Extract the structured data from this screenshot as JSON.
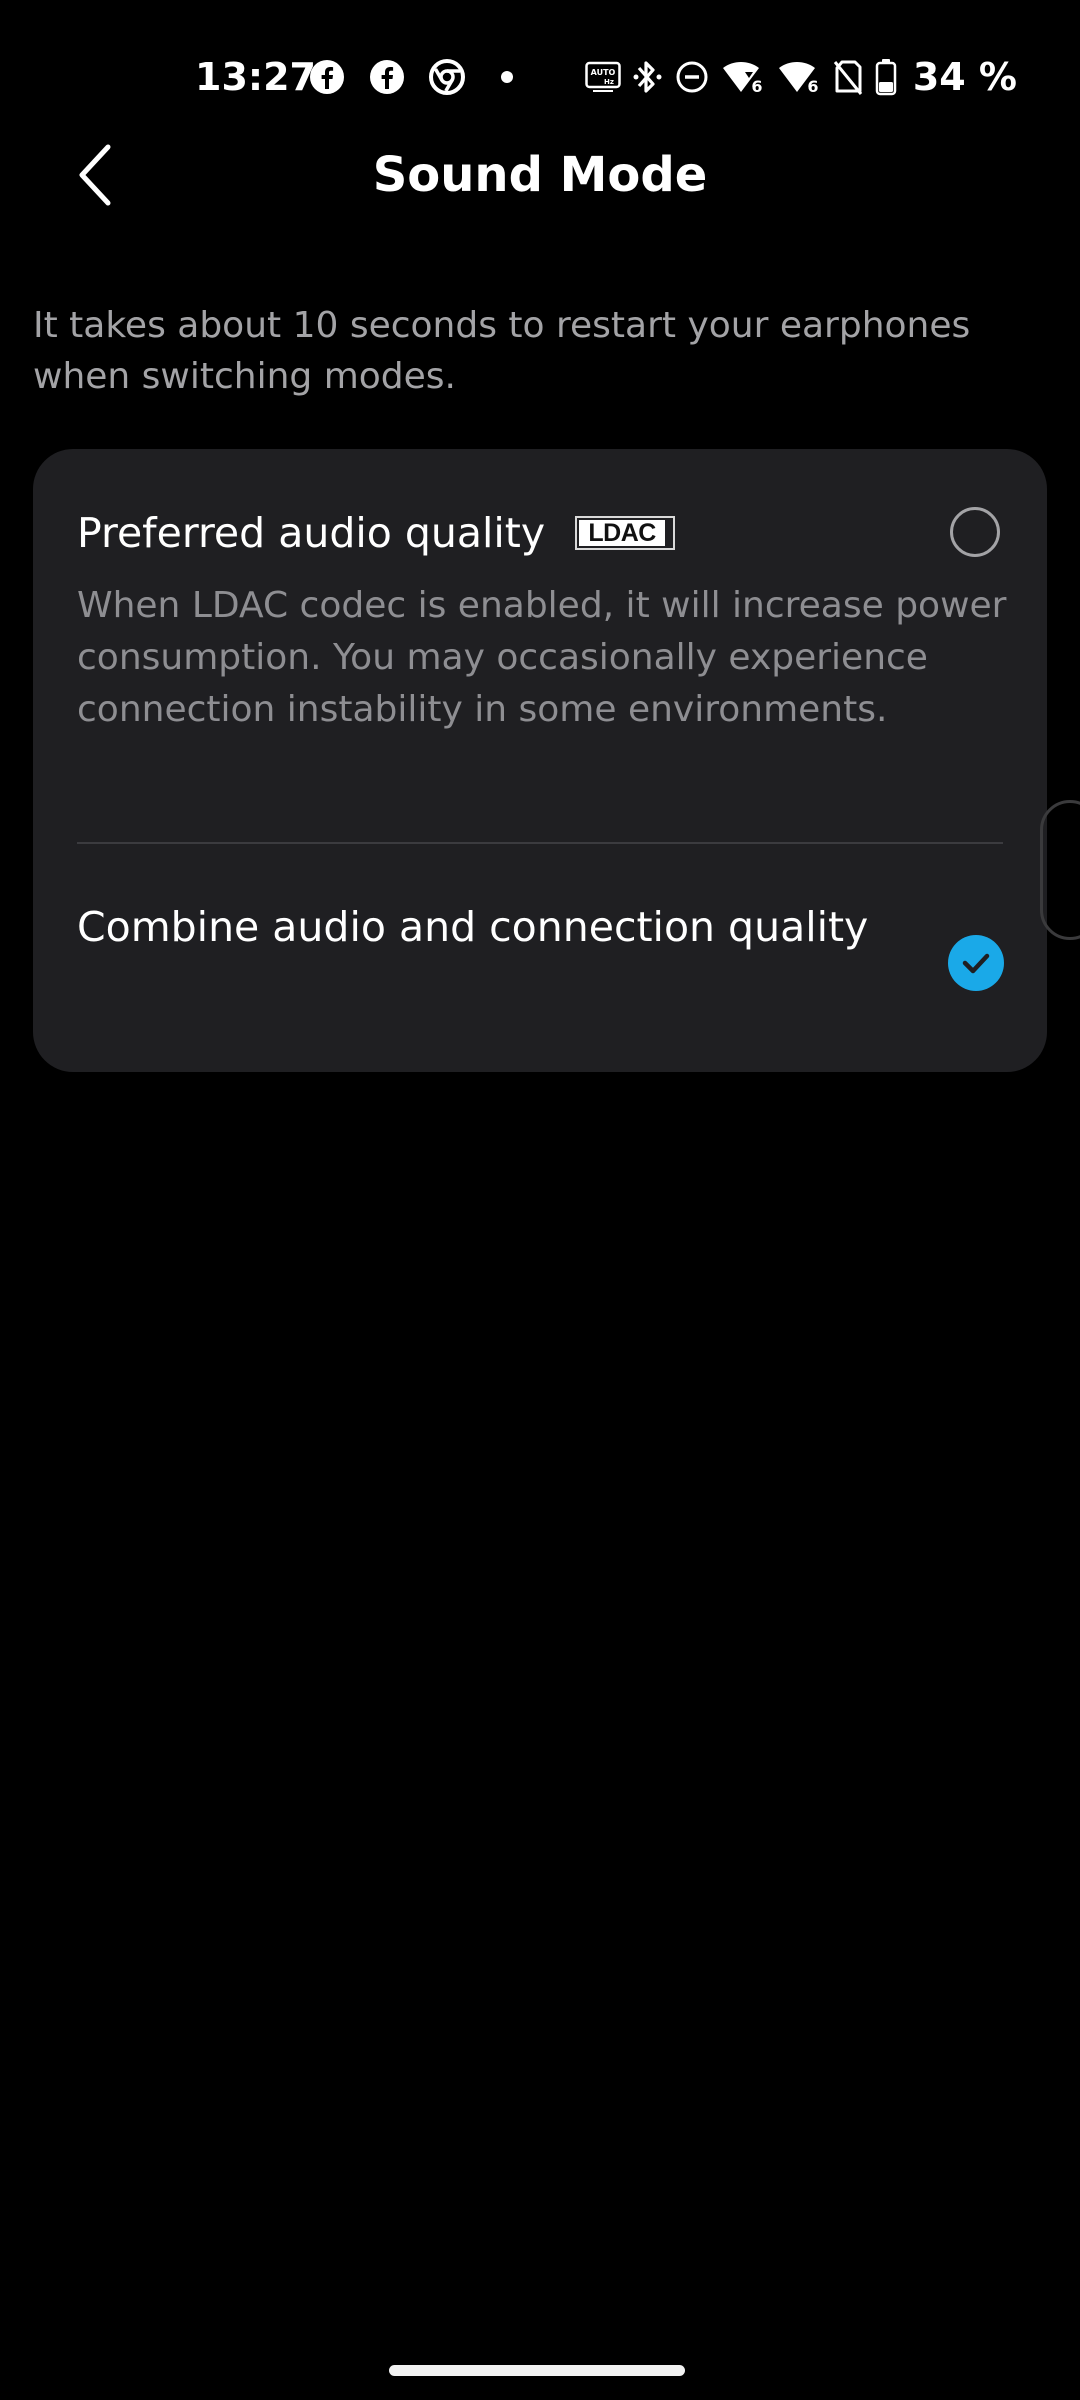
{
  "status_bar": {
    "time": "13:27",
    "battery_percent": "34 %",
    "left_icons": [
      "facebook-icon",
      "facebook-icon",
      "chrome-icon",
      "notification-dot-icon"
    ],
    "right_icons": [
      "auto-hz-icon",
      "bluetooth-icon",
      "do-not-disturb-icon",
      "wifi-6-icon",
      "wifi-6-icon",
      "no-sim-icon",
      "battery-icon"
    ]
  },
  "header": {
    "title": "Sound Mode",
    "back_icon": "chevron-left-icon"
  },
  "info": {
    "text": "It takes about 10 seconds to restart your earphones when switching modes."
  },
  "options": [
    {
      "title": "Preferred audio quality",
      "badge": "LDAC",
      "description": "When LDAC codec is enabled, it will increase power consumption. You may occasionally experience connection instability in some environments.",
      "selected": false
    },
    {
      "title": "Combine audio and connection quality",
      "selected": true
    }
  ],
  "colors": {
    "background": "#000000",
    "card": "#1f1f22",
    "accent": "#1aa9e8",
    "secondary_text": "#a3a3a6"
  }
}
